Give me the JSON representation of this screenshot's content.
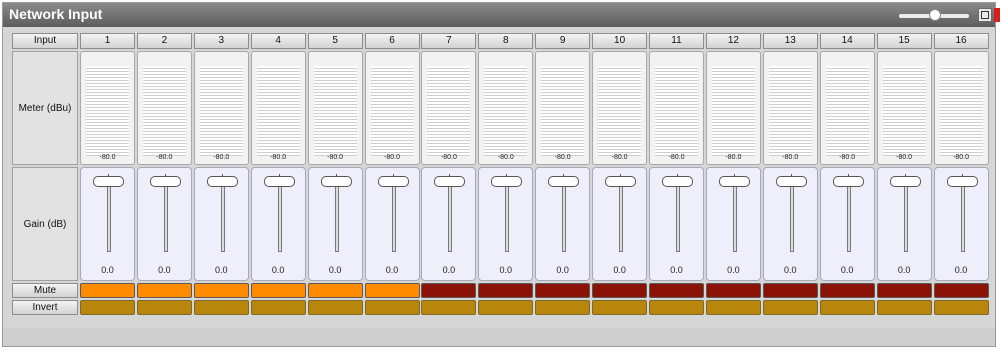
{
  "window": {
    "title": "Network Input"
  },
  "rows": {
    "input": "Input",
    "meter": "Meter (dBu)",
    "gain": "Gain (dB)",
    "mute": "Mute",
    "invert": "Invert"
  },
  "channels": [
    {
      "num": "1",
      "meter": "-80.0",
      "gain": "0.0",
      "mute_on": true
    },
    {
      "num": "2",
      "meter": "-80.0",
      "gain": "0.0",
      "mute_on": true
    },
    {
      "num": "3",
      "meter": "-80.0",
      "gain": "0.0",
      "mute_on": true
    },
    {
      "num": "4",
      "meter": "-80.0",
      "gain": "0.0",
      "mute_on": true
    },
    {
      "num": "5",
      "meter": "-80.0",
      "gain": "0.0",
      "mute_on": true
    },
    {
      "num": "6",
      "meter": "-80.0",
      "gain": "0.0",
      "mute_on": true
    },
    {
      "num": "7",
      "meter": "-80.0",
      "gain": "0.0",
      "mute_on": false
    },
    {
      "num": "8",
      "meter": "-80.0",
      "gain": "0.0",
      "mute_on": false
    },
    {
      "num": "9",
      "meter": "-80.0",
      "gain": "0.0",
      "mute_on": false
    },
    {
      "num": "10",
      "meter": "-80.0",
      "gain": "0.0",
      "mute_on": false
    },
    {
      "num": "11",
      "meter": "-80.0",
      "gain": "0.0",
      "mute_on": false
    },
    {
      "num": "12",
      "meter": "-80.0",
      "gain": "0.0",
      "mute_on": false
    },
    {
      "num": "13",
      "meter": "-80.0",
      "gain": "0.0",
      "mute_on": false
    },
    {
      "num": "14",
      "meter": "-80.0",
      "gain": "0.0",
      "mute_on": false
    },
    {
      "num": "15",
      "meter": "-80.0",
      "gain": "0.0",
      "mute_on": false
    },
    {
      "num": "16",
      "meter": "-80.0",
      "gain": "0.0",
      "mute_on": false
    }
  ],
  "colors": {
    "mute_active": "#ff8c00",
    "mute_inactive": "#8b1207",
    "invert": "#b8860b"
  },
  "icons": {
    "zoom": "zoom-slider-icon",
    "maximize": "maximize-icon",
    "close": "close-icon"
  }
}
